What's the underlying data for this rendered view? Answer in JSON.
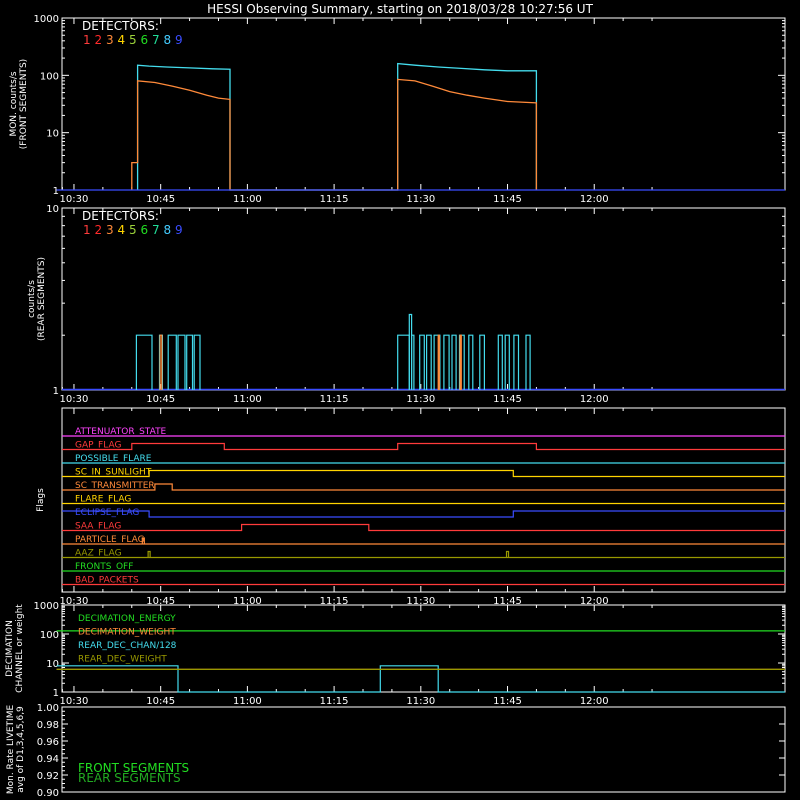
{
  "title": "HESSI Observing Summary, starting on 2018/03/28 10:27:56 UT",
  "time_ticks": [
    "10:30",
    "10:45",
    "11:00",
    "11:15",
    "11:30",
    "11:45",
    "12:00"
  ],
  "detector_colors": [
    "#ff3b3b",
    "#ff2a2a",
    "#ff8a3a",
    "#ffd400",
    "#9bd23a",
    "#22dd22",
    "#22dd99",
    "#44ccff",
    "#3a4cff"
  ],
  "chart_data": [
    {
      "type": "line",
      "panel": "front",
      "ylabel": [
        "MON. counts/s",
        "(FRONT SEGMENTS)"
      ],
      "yscale": "log",
      "ylim": [
        1,
        1000
      ],
      "yticks": [
        "1",
        "10",
        "100",
        "1000"
      ],
      "legend": {
        "title": "DETECTORS:",
        "entries": [
          {
            "label": "1",
            "color": "#ff3b3b"
          },
          {
            "label": "2",
            "color": "#ff2a2a"
          },
          {
            "label": "3",
            "color": "#ff8a3a"
          },
          {
            "label": "4",
            "color": "#ffd400"
          },
          {
            "label": "5",
            "color": "#9bd23a"
          },
          {
            "label": "6",
            "color": "#22dd22"
          },
          {
            "label": "7",
            "color": "#22dd99"
          },
          {
            "label": "8",
            "color": "#44ccff"
          },
          {
            "label": "9",
            "color": "#3a4cff"
          }
        ],
        "placement": "top-left"
      },
      "series": [
        {
          "color": "#44ddee",
          "points": [
            [
              "10:41",
              1
            ],
            [
              "10:41",
              150
            ],
            [
              "10:43",
              145
            ],
            [
              "10:46",
              140
            ],
            [
              "10:50",
              135
            ],
            [
              "10:54",
              130
            ],
            [
              "10:57",
              128
            ],
            [
              "10:57",
              1
            ],
            [
              "11:26",
              1
            ],
            [
              "11:26",
              160
            ],
            [
              "11:29",
              150
            ],
            [
              "11:33",
              140
            ],
            [
              "11:37",
              132
            ],
            [
              "11:41",
              125
            ],
            [
              "11:45",
              120
            ],
            [
              "11:50",
              120
            ],
            [
              "11:50",
              1
            ]
          ]
        },
        {
          "color": "#ff8a3a",
          "points": [
            [
              "10:40",
              1
            ],
            [
              "10:40",
              3
            ],
            [
              "10:41",
              3
            ],
            [
              "10:41",
              80
            ],
            [
              "10:44",
              75
            ],
            [
              "10:47",
              65
            ],
            [
              "10:50",
              55
            ],
            [
              "10:53",
              45
            ],
            [
              "10:55",
              40
            ],
            [
              "10:57",
              38
            ],
            [
              "10:57",
              1
            ],
            [
              "11:26",
              1
            ],
            [
              "11:26",
              85
            ],
            [
              "11:29",
              80
            ],
            [
              "11:32",
              65
            ],
            [
              "11:35",
              52
            ],
            [
              "11:38",
              45
            ],
            [
              "11:41",
              40
            ],
            [
              "11:45",
              35
            ],
            [
              "11:50",
              33
            ],
            [
              "11:50",
              1
            ]
          ]
        },
        {
          "color": "#3a4cff",
          "points": [
            [
              "10:27",
              1
            ],
            [
              "12:33",
              1
            ]
          ]
        }
      ]
    },
    {
      "type": "line",
      "panel": "rear",
      "ylabel": [
        "counts/s",
        "(REAR SEGMENTS)"
      ],
      "yscale": "log",
      "ylim": [
        1,
        10
      ],
      "yticks": [
        "1",
        "10"
      ],
      "legend": {
        "title": "DETECTORS:",
        "entries": [
          {
            "label": "1",
            "color": "#ff3b3b"
          },
          {
            "label": "2",
            "color": "#ff2a2a"
          },
          {
            "label": "3",
            "color": "#ff8a3a"
          },
          {
            "label": "4",
            "color": "#ffd400"
          },
          {
            "label": "5",
            "color": "#9bd23a"
          },
          {
            "label": "6",
            "color": "#22dd22"
          },
          {
            "label": "7",
            "color": "#22dd99"
          },
          {
            "label": "8",
            "color": "#44ccff"
          },
          {
            "label": "9",
            "color": "#3a4cff"
          }
        ],
        "placement": "top-left"
      },
      "series": [
        {
          "color": "#44ddee",
          "bursts": [
            [
              "10:40.8",
              "10:43.5",
              2
            ],
            [
              "10:44.8",
              "10:45.3",
              2
            ],
            [
              "10:46.3",
              "10:47.7",
              2
            ],
            [
              "10:48.0",
              "10:49.2",
              2
            ],
            [
              "10:49.5",
              "10:50.5",
              2
            ],
            [
              "10:50.8",
              "10:51.8",
              2
            ],
            [
              "11:26.0",
              "11:28.0",
              2
            ],
            [
              "11:28.0",
              "11:28.4",
              2.6
            ],
            [
              "11:28.4",
              "11:28.8",
              2
            ],
            [
              "11:29.8",
              "11:30.6",
              2
            ],
            [
              "11:31.0",
              "11:31.8",
              2
            ],
            [
              "11:32.3",
              "11:33.3",
              2
            ],
            [
              "11:34.0",
              "11:34.9",
              2
            ],
            [
              "11:35.4",
              "11:36.1",
              2
            ],
            [
              "11:36.7",
              "11:37.5",
              2
            ],
            [
              "11:38.3",
              "11:39.0",
              2
            ],
            [
              "11:40.2",
              "11:41.0",
              2
            ],
            [
              "11:43.4",
              "11:44.1",
              2
            ],
            [
              "11:44.6",
              "11:45.3",
              2
            ],
            [
              "11:46.1",
              "11:46.9",
              2
            ],
            [
              "11:48.2",
              "11:48.9",
              2
            ]
          ]
        },
        {
          "color": "#ff8a3a",
          "bursts": [
            [
              "10:44.9",
              "10:45.2",
              2
            ],
            [
              "11:33.0",
              "11:33.2",
              2
            ],
            [
              "11:36.8",
              "11:37.0",
              2
            ]
          ]
        }
      ],
      "baseline": {
        "color": "#3a4cff",
        "value": 1
      }
    },
    {
      "type": "line",
      "panel": "flags",
      "ylabel": [
        "Flags"
      ],
      "flags": [
        {
          "label": "ATTENUATOR_STATE",
          "color": "#ff44ff",
          "changes": []
        },
        {
          "label": "GAP_FLAG",
          "color": "#ff3b3b",
          "changes": [
            [
              "10:27",
              0
            ],
            [
              "10:40",
              1
            ],
            [
              "10:56",
              0
            ],
            [
              "11:26",
              1
            ],
            [
              "11:50",
              0
            ]
          ]
        },
        {
          "label": "POSSIBLE_FLARE",
          "color": "#44ddee",
          "changes": []
        },
        {
          "label": "SC_IN_SUNLIGHT",
          "color": "#ffd400",
          "changes": [
            [
              "10:27",
              0
            ],
            [
              "10:43",
              1
            ],
            [
              "11:46",
              0
            ]
          ]
        },
        {
          "label": "SC_TRANSMITTER",
          "color": "#ff8a3a",
          "changes": [
            [
              "10:27",
              0
            ],
            [
              "10:44",
              1
            ],
            [
              "10:47",
              0
            ]
          ]
        },
        {
          "label": "FLARE_FLAG",
          "color": "#ffd400",
          "changes": []
        },
        {
          "label": "ECLIPSE_FLAG",
          "color": "#3a4cff",
          "changes": [
            [
              "10:27",
              1
            ],
            [
              "10:43",
              0
            ],
            [
              "11:46",
              1
            ]
          ]
        },
        {
          "label": "SAA_FLAG",
          "color": "#ff3b3b",
          "changes": [
            [
              "10:27",
              0
            ],
            [
              "10:59",
              1
            ],
            [
              "11:21",
              0
            ]
          ]
        },
        {
          "label": "PARTICLE_FLAG",
          "color": "#ff8a3a",
          "changes": [],
          "spikes": [
            "10:42"
          ]
        },
        {
          "label": "AAZ_FLAG",
          "color": "#999900",
          "changes": [],
          "spikes": [
            "10:43",
            "11:45"
          ]
        },
        {
          "label": "FRONTS_OFF",
          "color": "#22dd22",
          "changes": []
        },
        {
          "label": "BAD_PACKETS",
          "color": "#ff3b3b",
          "changes": []
        }
      ]
    },
    {
      "type": "line",
      "panel": "decimation",
      "ylabel": [
        "DECIMATION",
        "CHANNEL or weight"
      ],
      "yscale": "log",
      "ylim": [
        1,
        1000
      ],
      "yticks": [
        "1",
        "10",
        "100",
        "1000"
      ],
      "series": [
        {
          "name": "DECIMATION_ENERGY",
          "color": "#22dd22",
          "points": [
            [
              "10:27",
              128
            ],
            [
              "12:33",
              128
            ]
          ]
        },
        {
          "name": "DECIMATION_WEIGHT",
          "color": "#ff8a3a",
          "points": [
            [
              "10:27",
              6
            ],
            [
              "12:33",
              6
            ]
          ]
        },
        {
          "name": "REAR_DEC_CHAN/128",
          "color": "#44ddee",
          "points": [
            [
              "10:27",
              8
            ],
            [
              "10:48",
              8
            ],
            [
              "10:48",
              1
            ],
            [
              "11:23",
              1
            ],
            [
              "11:23",
              8
            ],
            [
              "11:33",
              8
            ],
            [
              "11:33",
              1
            ],
            [
              "12:33",
              1
            ]
          ]
        },
        {
          "name": "REAR_DEC_WEIGHT",
          "color": "#999900",
          "points": [
            [
              "10:27",
              6
            ],
            [
              "12:33",
              6
            ]
          ]
        }
      ]
    },
    {
      "type": "line",
      "panel": "livetime",
      "ylabel": [
        "Mon. Rate LIVETIME",
        "avg of D1,3,4,5,6,9"
      ],
      "ylim": [
        0.9,
        1.0
      ],
      "yticks": [
        "0.90",
        "0.92",
        "0.94",
        "0.96",
        "0.98",
        "1.00"
      ],
      "series": [
        {
          "name": "FRONT SEGMENTS",
          "color": "#22dd22",
          "points": []
        },
        {
          "name": "REAR SEGMENTS",
          "color": "#22aa22",
          "points": []
        }
      ]
    }
  ]
}
